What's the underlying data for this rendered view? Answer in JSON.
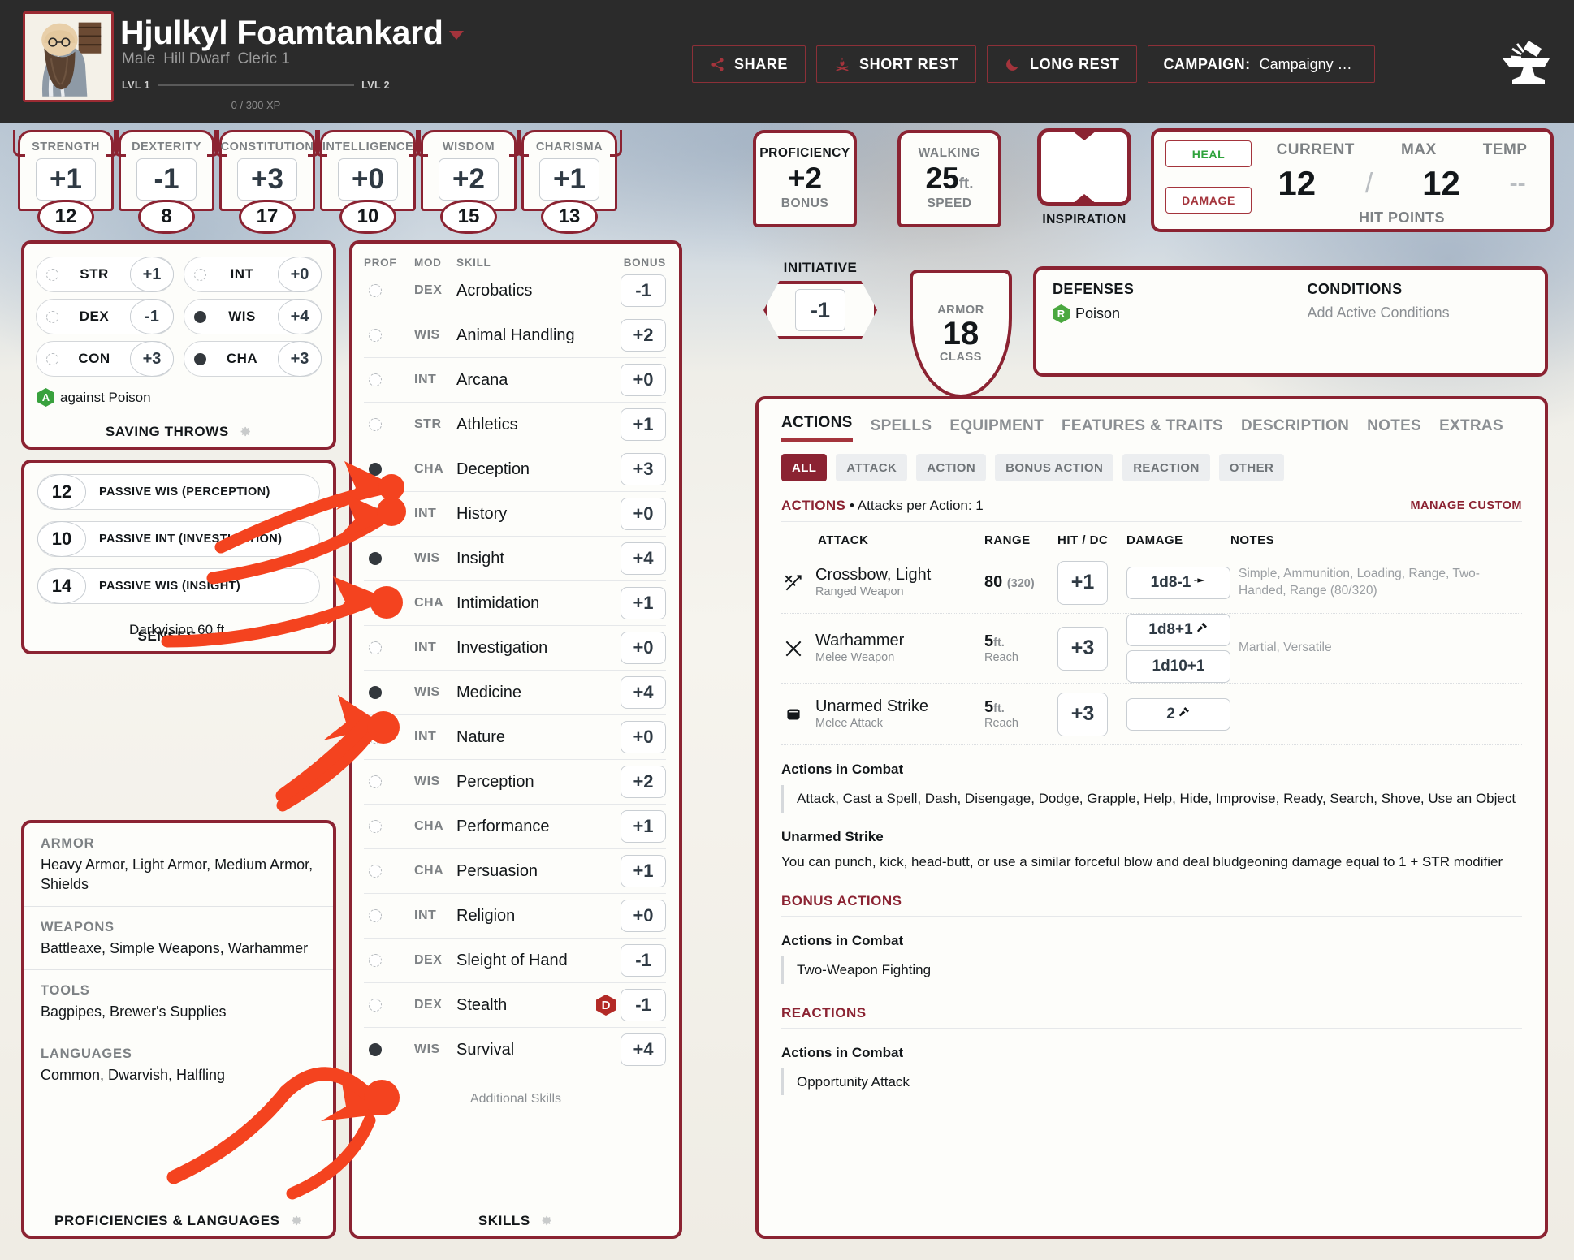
{
  "character": {
    "name": "Hjulkyl Foamtankard",
    "gender": "Male",
    "race": "Hill Dwarf",
    "class_level": "Cleric 1",
    "level_from": "LVL 1",
    "level_to": "LVL 2",
    "xp": "0 / 300 XP"
  },
  "header_buttons": {
    "share": "SHARE",
    "short_rest": "SHORT REST",
    "long_rest": "LONG REST",
    "campaign_label": "CAMPAIGN:",
    "campaign_value": "Campaigny McCampaignfa…"
  },
  "abilities": [
    {
      "name": "STRENGTH",
      "mod": "+1",
      "score": "12"
    },
    {
      "name": "DEXTERITY",
      "mod": "-1",
      "score": "8"
    },
    {
      "name": "CONSTITUTION",
      "mod": "+3",
      "score": "17"
    },
    {
      "name": "INTELLIGENCE",
      "mod": "+0",
      "score": "10"
    },
    {
      "name": "WISDOM",
      "mod": "+2",
      "score": "15"
    },
    {
      "name": "CHARISMA",
      "mod": "+1",
      "score": "13"
    }
  ],
  "proficiency": {
    "top": "PROFICIENCY",
    "value": "+2",
    "bottom": "BONUS"
  },
  "speed": {
    "top": "WALKING",
    "value": "25",
    "unit": "ft.",
    "bottom": "SPEED"
  },
  "inspiration": {
    "label": "INSPIRATION"
  },
  "hitpoints": {
    "heal": "HEAL",
    "damage": "DAMAGE",
    "current_label": "CURRENT",
    "max_label": "MAX",
    "temp_label": "TEMP",
    "current": "12",
    "separator": "/",
    "max": "12",
    "temp": "--",
    "footer": "HIT POINTS"
  },
  "saving_throws": {
    "footer": "SAVING THROWS",
    "items": [
      {
        "ability": "STR",
        "value": "+1",
        "proficient": false
      },
      {
        "ability": "INT",
        "value": "+0",
        "proficient": false
      },
      {
        "ability": "DEX",
        "value": "-1",
        "proficient": false
      },
      {
        "ability": "WIS",
        "value": "+4",
        "proficient": true
      },
      {
        "ability": "CON",
        "value": "+3",
        "proficient": false
      },
      {
        "ability": "CHA",
        "value": "+3",
        "proficient": true
      }
    ],
    "note_badge": "A",
    "note": "against Poison"
  },
  "senses": {
    "footer": "SENSES",
    "items": [
      {
        "value": "12",
        "label": "PASSIVE WIS (PERCEPTION)"
      },
      {
        "value": "10",
        "label": "PASSIVE INT (INVESTIGATION)"
      },
      {
        "value": "14",
        "label": "PASSIVE WIS (INSIGHT)"
      }
    ],
    "extra": "Darkvision 60 ft."
  },
  "proficiencies": {
    "footer": "PROFICIENCIES & LANGUAGES",
    "sections": [
      {
        "title": "ARMOR",
        "value": "Heavy Armor, Light Armor, Medium Armor, Shields"
      },
      {
        "title": "WEAPONS",
        "value": "Battleaxe, Simple Weapons, Warhammer"
      },
      {
        "title": "TOOLS",
        "value": "Bagpipes, Brewer's Supplies"
      },
      {
        "title": "LANGUAGES",
        "value": "Common, Dwarvish, Halfling"
      }
    ]
  },
  "skills": {
    "footer": "SKILLS",
    "columns": {
      "prof": "PROF",
      "mod": "MOD",
      "skill": "SKILL",
      "bonus": "BONUS"
    },
    "additional": "Additional Skills",
    "rows": [
      {
        "proficient": false,
        "mod": "DEX",
        "name": "Acrobatics",
        "bonus": "-1",
        "flag": ""
      },
      {
        "proficient": false,
        "mod": "WIS",
        "name": "Animal Handling",
        "bonus": "+2",
        "flag": ""
      },
      {
        "proficient": false,
        "mod": "INT",
        "name": "Arcana",
        "bonus": "+0",
        "flag": ""
      },
      {
        "proficient": false,
        "mod": "STR",
        "name": "Athletics",
        "bonus": "+1",
        "flag": ""
      },
      {
        "proficient": true,
        "mod": "CHA",
        "name": "Deception",
        "bonus": "+3",
        "flag": ""
      },
      {
        "proficient": false,
        "mod": "INT",
        "name": "History",
        "bonus": "+0",
        "flag": ""
      },
      {
        "proficient": true,
        "mod": "WIS",
        "name": "Insight",
        "bonus": "+4",
        "flag": ""
      },
      {
        "proficient": false,
        "mod": "CHA",
        "name": "Intimidation",
        "bonus": "+1",
        "flag": ""
      },
      {
        "proficient": false,
        "mod": "INT",
        "name": "Investigation",
        "bonus": "+0",
        "flag": ""
      },
      {
        "proficient": true,
        "mod": "WIS",
        "name": "Medicine",
        "bonus": "+4",
        "flag": ""
      },
      {
        "proficient": false,
        "mod": "INT",
        "name": "Nature",
        "bonus": "+0",
        "flag": ""
      },
      {
        "proficient": false,
        "mod": "WIS",
        "name": "Perception",
        "bonus": "+2",
        "flag": ""
      },
      {
        "proficient": false,
        "mod": "CHA",
        "name": "Performance",
        "bonus": "+1",
        "flag": ""
      },
      {
        "proficient": false,
        "mod": "CHA",
        "name": "Persuasion",
        "bonus": "+1",
        "flag": ""
      },
      {
        "proficient": false,
        "mod": "INT",
        "name": "Religion",
        "bonus": "+0",
        "flag": ""
      },
      {
        "proficient": false,
        "mod": "DEX",
        "name": "Sleight of Hand",
        "bonus": "-1",
        "flag": ""
      },
      {
        "proficient": false,
        "mod": "DEX",
        "name": "Stealth",
        "bonus": "-1",
        "flag": "D"
      },
      {
        "proficient": true,
        "mod": "WIS",
        "name": "Survival",
        "bonus": "+4",
        "flag": ""
      }
    ]
  },
  "initiative": {
    "label": "INITIATIVE",
    "value": "-1"
  },
  "armor_class": {
    "top": "ARMOR",
    "value": "18",
    "bottom": "CLASS"
  },
  "defenses": {
    "title": "DEFENSES",
    "items": [
      {
        "badge": "R",
        "label": "Poison"
      }
    ]
  },
  "conditions": {
    "title": "CONDITIONS",
    "placeholder": "Add Active Conditions"
  },
  "main": {
    "tabs": [
      {
        "label": "ACTIONS",
        "active": true
      },
      {
        "label": "SPELLS",
        "active": false
      },
      {
        "label": "EQUIPMENT",
        "active": false
      },
      {
        "label": "FEATURES & TRAITS",
        "active": false
      },
      {
        "label": "DESCRIPTION",
        "active": false
      },
      {
        "label": "NOTES",
        "active": false
      },
      {
        "label": "EXTRAS",
        "active": false
      }
    ],
    "filters": [
      {
        "label": "ALL",
        "active": true
      },
      {
        "label": "ATTACK",
        "active": false
      },
      {
        "label": "ACTION",
        "active": false
      },
      {
        "label": "BONUS ACTION",
        "active": false
      },
      {
        "label": "REACTION",
        "active": false
      },
      {
        "label": "OTHER",
        "active": false
      }
    ],
    "actions_header": {
      "title": "ACTIONS",
      "subtitle": "• Attacks per Action: 1",
      "manage": "MANAGE CUSTOM"
    },
    "attack_columns": {
      "attack": "ATTACK",
      "range": "RANGE",
      "hit": "HIT / DC",
      "damage": "DAMAGE",
      "notes": "NOTES"
    },
    "attacks": [
      {
        "icon": "crossbow-icon",
        "name": "Crossbow, Light",
        "subtitle": "Ranged Weapon",
        "range": "80",
        "range_paren": "(320)",
        "range_unit": "",
        "range_sub": "",
        "hit": "+1",
        "damage": [
          "1d8-1"
        ],
        "notes": "Simple, Ammunition, Loading, Range, Two-Handed, Range (80/320)"
      },
      {
        "icon": "warhammer-icon",
        "name": "Warhammer",
        "subtitle": "Melee Weapon",
        "range": "5",
        "range_paren": "",
        "range_unit": "ft.",
        "range_sub": "Reach",
        "hit": "+3",
        "damage": [
          "1d8+1",
          "1d10+1"
        ],
        "notes": "Martial, Versatile"
      },
      {
        "icon": "fist-icon",
        "name": "Unarmed Strike",
        "subtitle": "Melee Attack",
        "range": "5",
        "range_paren": "",
        "range_unit": "ft.",
        "range_sub": "Reach",
        "hit": "+3",
        "damage": [
          "2"
        ],
        "notes": ""
      }
    ],
    "blocks": [
      {
        "heading": "Actions in Combat",
        "quote": "Attack,  Cast a Spell,  Dash,  Disengage,  Dodge,  Grapple,  Help,  Hide,  Improvise,  Ready,  Search,  Shove, Use an Object",
        "body": ""
      },
      {
        "heading": "Unarmed Strike",
        "quote": "",
        "body": "You can punch, kick, head-butt, or use a similar forceful blow and deal bludgeoning damage equal to 1 + STR modifier"
      }
    ],
    "bonus_actions": {
      "title": "BONUS ACTIONS",
      "heading": "Actions in Combat",
      "quote": "Two-Weapon Fighting"
    },
    "reactions": {
      "title": "REACTIONS",
      "heading": "Actions in Combat",
      "quote": "Opportunity Attack"
    }
  },
  "colors": {
    "accent_red": "#8b2332",
    "annotation_orange": "#f4431f",
    "green_badge": "#38a13d",
    "dark_bg": "#2b2b2b"
  }
}
